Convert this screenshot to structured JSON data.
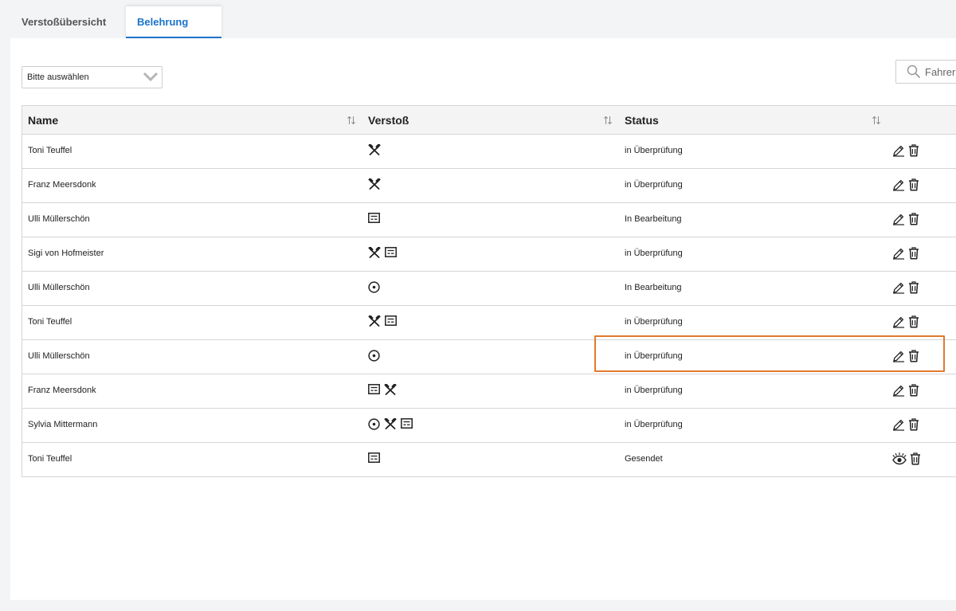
{
  "tabs": [
    {
      "label": "Verstoßübersicht",
      "active": false
    },
    {
      "label": "Belehrung",
      "active": true
    }
  ],
  "filter": {
    "selected": "Bitte auswählen"
  },
  "search": {
    "placeholder": "Fahrer"
  },
  "table": {
    "columns": [
      "Name",
      "Verstoß",
      "Status"
    ],
    "rows": [
      {
        "name": "Toni Teuffel",
        "violations": [
          "hammer-icon"
        ],
        "status": "in Überprüfung",
        "actions": [
          "edit-icon",
          "trash-icon"
        ]
      },
      {
        "name": "Franz Meersdonk",
        "violations": [
          "hammer-icon"
        ],
        "status": "in Überprüfung",
        "actions": [
          "edit-icon",
          "trash-icon"
        ]
      },
      {
        "name": "Ulli Müllerschön",
        "violations": [
          "document-icon"
        ],
        "status": "In Bearbeitung",
        "actions": [
          "edit-icon",
          "trash-icon"
        ]
      },
      {
        "name": "Sigi von Hofmeister",
        "violations": [
          "hammer-icon",
          "document-icon"
        ],
        "status": "in Überprüfung",
        "actions": [
          "edit-icon",
          "trash-icon"
        ]
      },
      {
        "name": "Ulli Müllerschön",
        "violations": [
          "target-icon"
        ],
        "status": "In Bearbeitung",
        "actions": [
          "edit-icon",
          "trash-icon"
        ]
      },
      {
        "name": "Toni Teuffel",
        "violations": [
          "hammer-icon",
          "document-icon"
        ],
        "status": "in Überprüfung",
        "actions": [
          "edit-icon",
          "trash-icon"
        ]
      },
      {
        "name": "Ulli Müllerschön",
        "violations": [
          "target-icon"
        ],
        "status": "in Überprüfung",
        "actions": [
          "edit-icon",
          "trash-icon"
        ],
        "highlighted": true
      },
      {
        "name": "Franz Meersdonk",
        "violations": [
          "document-icon",
          "hammer-icon"
        ],
        "status": "in Überprüfung",
        "actions": [
          "edit-icon",
          "trash-icon"
        ]
      },
      {
        "name": "Sylvia Mittermann",
        "violations": [
          "target-icon",
          "hammer-icon",
          "document-icon"
        ],
        "status": "in Überprüfung",
        "actions": [
          "edit-icon",
          "trash-icon"
        ]
      },
      {
        "name": "Toni Teuffel",
        "violations": [
          "document-icon"
        ],
        "status": "Gesendet",
        "actions": [
          "eye-icon",
          "trash-icon"
        ]
      }
    ]
  },
  "colors": {
    "accent": "#1a73c8",
    "highlight": "#e07a2e"
  }
}
